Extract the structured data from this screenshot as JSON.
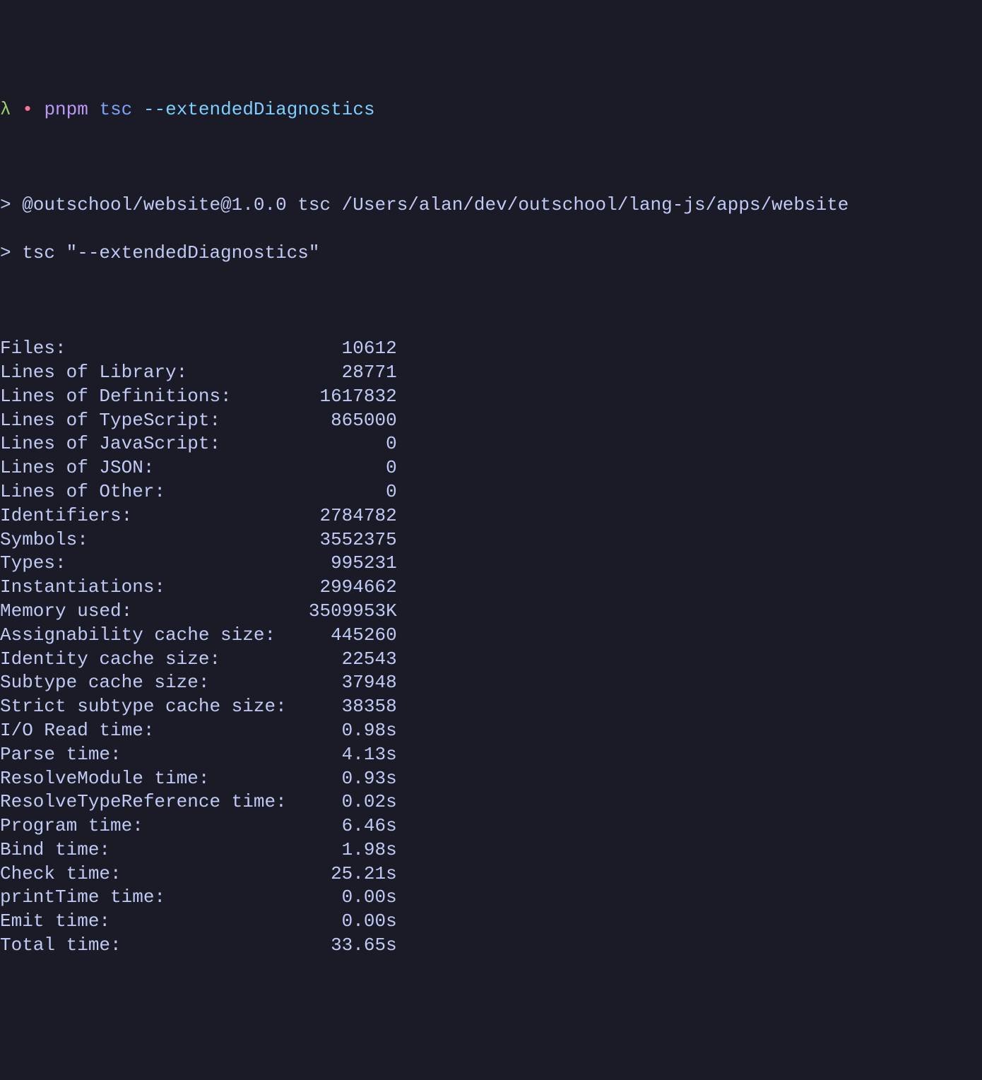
{
  "prompt": {
    "lambda": "λ",
    "bullet": "•",
    "pnpm": "pnpm",
    "tsc": "tsc",
    "flag": "--extendedDiagnostics"
  },
  "output": {
    "line1": "> @outschool/website@1.0.0 tsc /Users/alan/dev/outschool/lang-js/apps/website",
    "line2": "> tsc \"--extendedDiagnostics\""
  },
  "diagnostics": [
    {
      "label": "Files:",
      "value": "10612"
    },
    {
      "label": "Lines of Library:",
      "value": "28771"
    },
    {
      "label": "Lines of Definitions:",
      "value": "1617832"
    },
    {
      "label": "Lines of TypeScript:",
      "value": "865000"
    },
    {
      "label": "Lines of JavaScript:",
      "value": "0"
    },
    {
      "label": "Lines of JSON:",
      "value": "0"
    },
    {
      "label": "Lines of Other:",
      "value": "0"
    },
    {
      "label": "Identifiers:",
      "value": "2784782"
    },
    {
      "label": "Symbols:",
      "value": "3552375"
    },
    {
      "label": "Types:",
      "value": "995231"
    },
    {
      "label": "Instantiations:",
      "value": "2994662"
    },
    {
      "label": "Memory used:",
      "value": "3509953K"
    },
    {
      "label": "Assignability cache size:",
      "value": "445260"
    },
    {
      "label": "Identity cache size:",
      "value": "22543"
    },
    {
      "label": "Subtype cache size:",
      "value": "37948"
    },
    {
      "label": "Strict subtype cache size:",
      "value": "38358"
    },
    {
      "label": "I/O Read time:",
      "value": "0.98s"
    },
    {
      "label": "Parse time:",
      "value": "4.13s"
    },
    {
      "label": "ResolveModule time:",
      "value": "0.93s"
    },
    {
      "label": "ResolveTypeReference time:",
      "value": "0.02s"
    },
    {
      "label": "Program time:",
      "value": "6.46s"
    },
    {
      "label": "Bind time:",
      "value": "1.98s"
    },
    {
      "label": "Check time:",
      "value": "25.21s"
    },
    {
      "label": "printTime time:",
      "value": "0.00s"
    },
    {
      "label": "Emit time:",
      "value": "0.00s"
    },
    {
      "label": "Total time:",
      "value": "33.65s"
    }
  ]
}
